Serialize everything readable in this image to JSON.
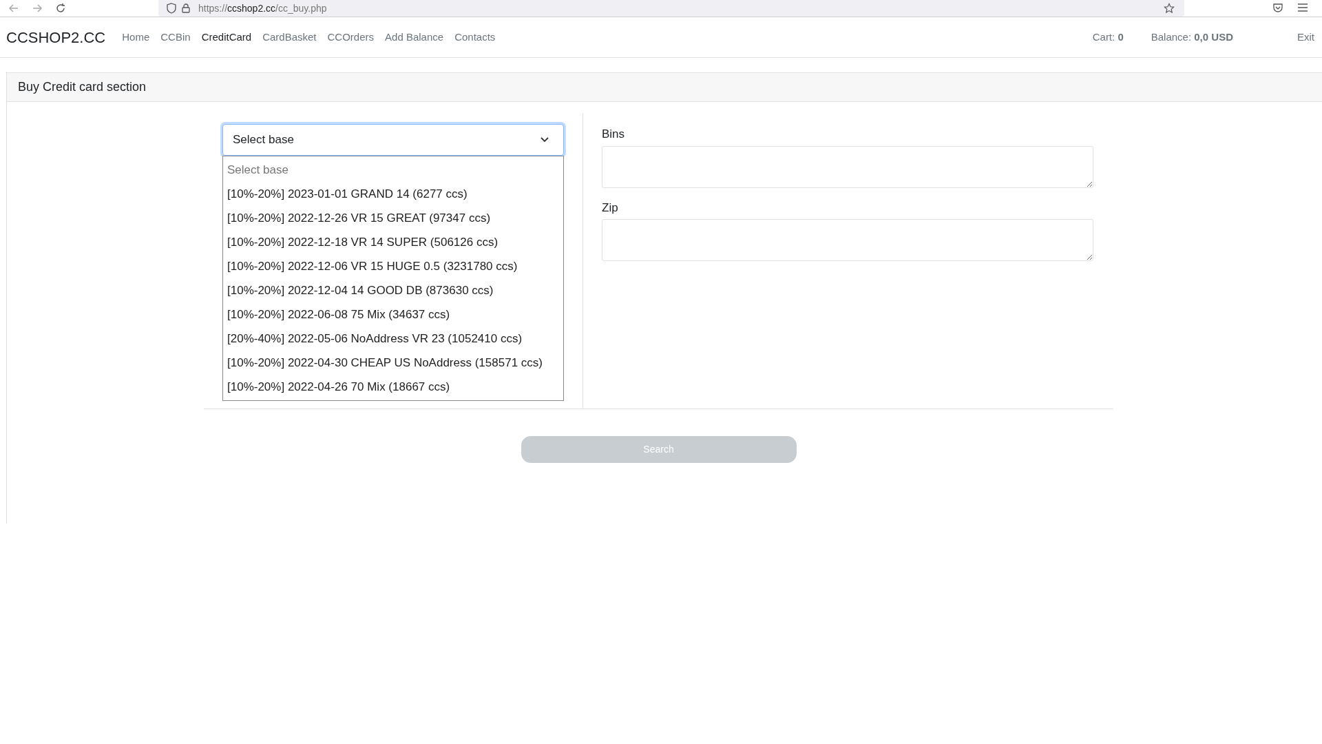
{
  "browser": {
    "url": {
      "scheme": "https://",
      "host": "ccshop2.cc",
      "path": "/cc_buy.php"
    }
  },
  "navbar": {
    "brand": "CCSHOP2.CC",
    "items": [
      {
        "label": "Home",
        "selected": false
      },
      {
        "label": "CCBin",
        "selected": false
      },
      {
        "label": "CreditCard",
        "selected": true
      },
      {
        "label": "CardBasket",
        "selected": false
      },
      {
        "label": "CCOrders",
        "selected": false
      },
      {
        "label": "Add Balance",
        "selected": false
      },
      {
        "label": "Contacts",
        "selected": false
      }
    ],
    "cart": "Cart: **0**",
    "balance": "Balance: **0,0 USD**",
    "exit": "Exit"
  },
  "card": {
    "title": "Buy Credit card section"
  },
  "base_select": {
    "value": "Select base",
    "expanded": true,
    "options": [
      {
        "label": "Select base",
        "disabled": true
      },
      {
        "label": "[10%-20%] 2023-01-01 GRAND 14 (6277 ccs)",
        "disabled": false
      },
      {
        "label": "[10%-20%] 2022-12-26 VR 15 GREAT (97347 ccs)",
        "disabled": false
      },
      {
        "label": "[10%-20%] 2022-12-18 VR 14 SUPER (506126 ccs)",
        "disabled": false
      },
      {
        "label": "[10%-20%] 2022-12-06 VR 15 HUGE 0.5 (3231780 ccs)",
        "disabled": false
      },
      {
        "label": "[10%-20%] 2022-12-04 14 GOOD DB (873630 ccs)",
        "disabled": false
      },
      {
        "label": "[10%-20%] 2022-06-08 75 Mix (34637 ccs)",
        "disabled": false
      },
      {
        "label": "[20%-40%] 2022-05-06 NoAddress VR 23 (1052410 ccs)",
        "disabled": false
      },
      {
        "label": "[10%-20%] 2022-04-30 CHEAP US NoAddress (158571 ccs)",
        "disabled": false
      },
      {
        "label": "[10%-20%] 2022-04-26 70 Mix (18667 ccs)",
        "disabled": false
      }
    ]
  },
  "fields": [
    {
      "label": "Bins"
    },
    {
      "label": "Zip"
    }
  ],
  "search_button": {
    "label": "Search",
    "disabled": true
  }
}
